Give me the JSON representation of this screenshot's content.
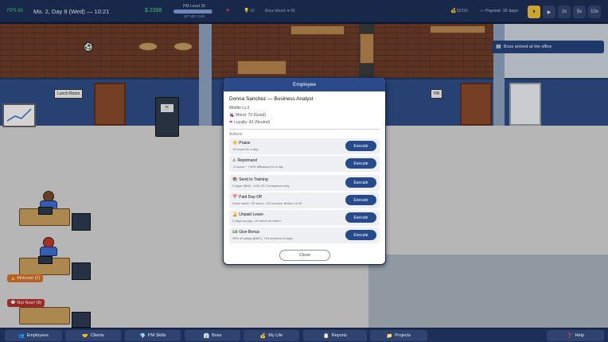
{
  "hud": {
    "fps": "FPS 60",
    "date": "Mo. 2, Day 8 (Wed) — 10:21",
    "money": "$ 2398",
    "pm_level": "PM Level 36",
    "pm_progress": 0.95,
    "pm_xp": "XP 100 / 100",
    "heart_value": "♥",
    "bulb_value": "10",
    "boss_mood": "Boss Mood: ♥ 65",
    "coins_value": "$2250",
    "payrest": "— Payrest: 32 days",
    "speed_buttons": [
      {
        "label": "⏸",
        "active": true
      },
      {
        "label": "▶",
        "active": false
      },
      {
        "label": "2x",
        "active": false
      },
      {
        "label": "5x",
        "active": false
      },
      {
        "label": "10x",
        "active": false
      }
    ]
  },
  "scene": {
    "signs": {
      "lunch_room": "Lunch Room",
      "hr": "HR"
    },
    "tags": {
      "motivate": "Motivate (2)",
      "not_now": "Not Now! (8)"
    },
    "notification": "Boss arrived at the office"
  },
  "dialog": {
    "title": "Employee",
    "employee": {
      "name": "Donna Sanchez — Business Analyst",
      "level": "Middle Lv.3",
      "mood": "Mood: 73 (Good)",
      "loyalty": "Loyalty: 43 (Neutral)"
    },
    "actions_label": "Actions",
    "actions": [
      {
        "icon": "👏",
        "title": "Praise",
        "desc": "+5 mood for a day",
        "button": "Execute"
      },
      {
        "icon": "⚠",
        "title": "Reprimand",
        "desc": "-3 mood ~ +15% efficiency for a day",
        "button": "Execute"
      },
      {
        "icon": "📚",
        "title": "Send to Training",
        "desc": "2 days, $900, +100 XP. Contractors only",
        "button": "Execute"
      },
      {
        "icon": "📅",
        "title": "Paid Day-Off",
        "desc": "Goes home, +8 mood, -1% burnout. Before 11:00",
        "button": "Execute"
      },
      {
        "icon": "🔔",
        "title": "Unpaid Leave",
        "desc": "2 days no pay, -15 mood on return",
        "button": "Execute"
      },
      {
        "icon": "💵",
        "title": "Give Bonus",
        "desc": "25% of salary ($487), +15 mood for 5 days",
        "button": "Execute"
      }
    ],
    "close_label": "Close"
  },
  "bottom_nav": [
    {
      "icon": "👥",
      "label": "Employees"
    },
    {
      "icon": "🤝",
      "label": "Clients"
    },
    {
      "icon": "💎",
      "label": "PM Skills"
    },
    {
      "icon": "👔",
      "label": "Boss"
    },
    {
      "icon": "💰",
      "label": "My Life"
    },
    {
      "icon": "📋",
      "label": "Reports"
    },
    {
      "icon": "📁",
      "label": "Projects"
    },
    {
      "icon": "❓",
      "label": "Help"
    }
  ],
  "colors": {
    "hud_bg": "#1c2f58",
    "accent_blue": "#264a8c",
    "speed_active": "#f0c234",
    "money_green": "#4be07e"
  }
}
